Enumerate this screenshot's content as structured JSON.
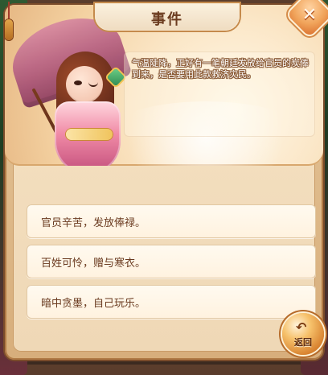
{
  "dialog": {
    "title": "事件",
    "event_text": "气温陡降，正好有一笔朝廷发放给官员的炭俸到来，是否要用此款救济灾民。",
    "options": [
      {
        "label": "官员辛苦，发放俸禄。"
      },
      {
        "label": "百姓可怜，赠与寒衣。"
      },
      {
        "label": "暗中贪墨，自己玩乐。"
      }
    ],
    "back_label": "返回",
    "close_icon": "close-icon",
    "back_icon": "back-arrow-icon"
  },
  "colors": {
    "title_text": "#6b3b1f",
    "option_text": "#6a3a1f",
    "close_button": "#e58a3f",
    "back_button": "#f2b35b"
  }
}
